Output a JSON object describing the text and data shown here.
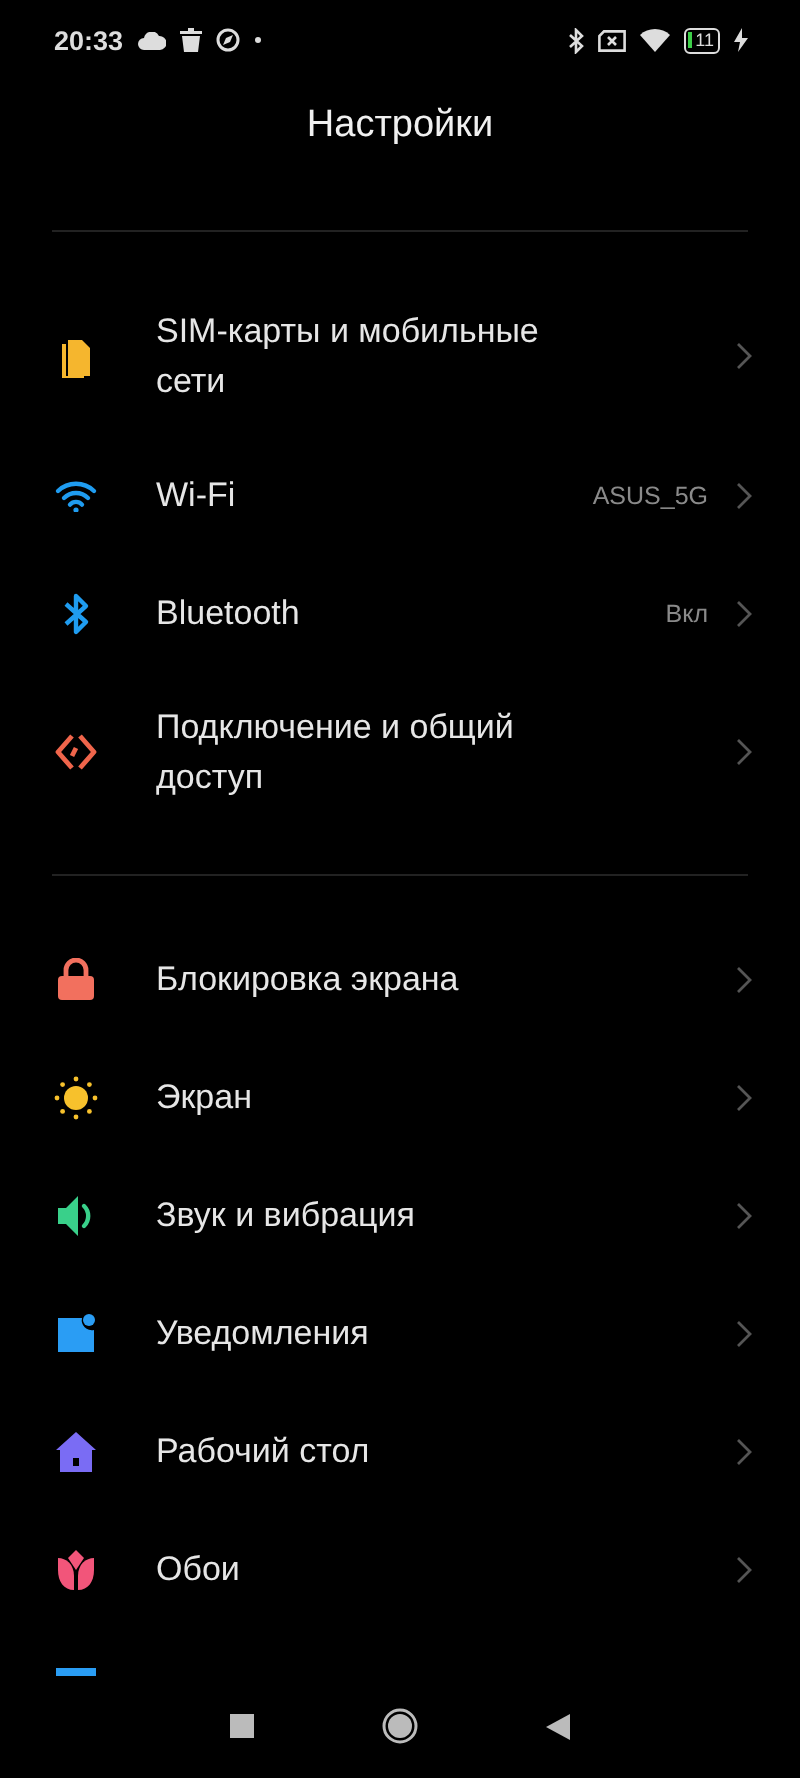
{
  "status_bar": {
    "time": "20:33",
    "battery": "11",
    "charging": true
  },
  "title": "Настройки",
  "sections": [
    {
      "items": [
        {
          "kind": "sim",
          "color": "#f5b62e",
          "label": "SIM-карты и мобильные сети"
        },
        {
          "kind": "wifi",
          "color": "#1f9cf0",
          "label": "Wi-Fi",
          "value": "ASUS_5G"
        },
        {
          "kind": "bluetooth",
          "color": "#1f9cf0",
          "label": "Bluetooth",
          "value": "Вкл"
        },
        {
          "kind": "share",
          "color": "#f0654b",
          "label": "Подключение и общий доступ"
        }
      ]
    },
    {
      "items": [
        {
          "kind": "lock",
          "color": "#f2705e",
          "label": "Блокировка экрана"
        },
        {
          "kind": "sun",
          "color": "#f7c12c",
          "label": "Экран"
        },
        {
          "kind": "sound",
          "color": "#39d08a",
          "label": "Звук и вибрация"
        },
        {
          "kind": "notification",
          "color": "#2a9df4",
          "label": "Уведомления"
        },
        {
          "kind": "home",
          "color": "#7a6cf4",
          "label": "Рабочий стол"
        },
        {
          "kind": "flower",
          "color": "#f2557a",
          "label": "Обои"
        },
        {
          "kind": "bar",
          "color": "#2a9df4"
        }
      ]
    }
  ]
}
